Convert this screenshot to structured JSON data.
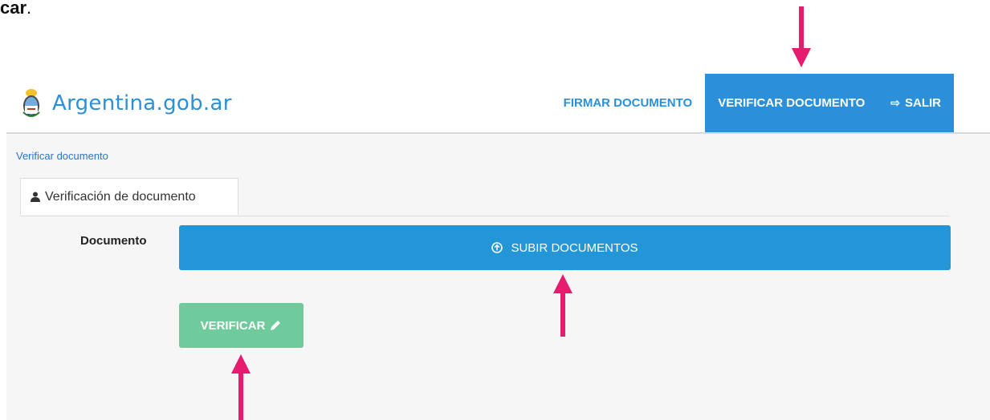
{
  "caption": {
    "prefix": "",
    "bold": "car",
    "suffix": "."
  },
  "header": {
    "brand": "Argentina.gob.ar",
    "nav": {
      "sign": "FIRMAR DOCUMENTO",
      "verify": "VERIFICAR DOCUMENTO",
      "logout": "SALIR"
    }
  },
  "breadcrumb": "Verificar documento",
  "tab": {
    "label": "Verificación de documento"
  },
  "form": {
    "document_label": "Documento",
    "upload_label": "SUBIR DOCUMENTOS",
    "verify_label": "VERIFICAR"
  },
  "colors": {
    "primary": "#2B90D9",
    "success": "#6FCB9B",
    "annotation_arrow": "#E81C6E"
  },
  "icons": [
    "coat-of-arms-icon",
    "sign-out-icon",
    "user-icon",
    "upload-circle-icon",
    "pencil-icon",
    "arrow-down-icon",
    "arrow-up-icon"
  ]
}
